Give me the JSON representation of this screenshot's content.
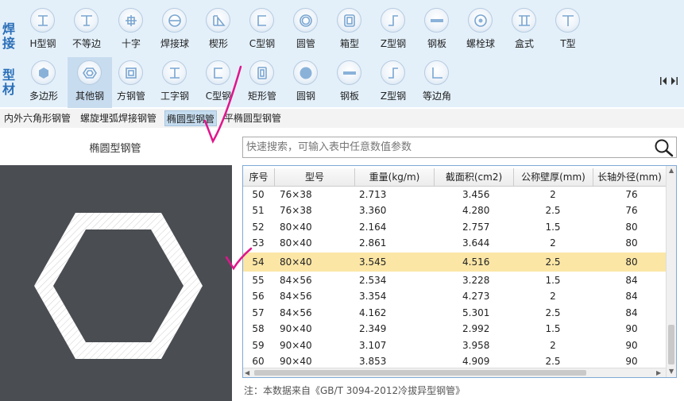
{
  "side_labels": {
    "top": [
      "焊",
      "接"
    ],
    "bottom": [
      "型",
      "材"
    ]
  },
  "toolbar": {
    "row1": [
      {
        "label": "H型钢",
        "icon": "h-beam-icon"
      },
      {
        "label": "不等边",
        "icon": "unequal-beam-icon"
      },
      {
        "label": "十字",
        "icon": "cross-icon"
      },
      {
        "label": "焊接球",
        "icon": "welded-ball-icon"
      },
      {
        "label": "楔形",
        "icon": "wedge-icon"
      },
      {
        "label": "C型钢",
        "icon": "c-channel-icon"
      },
      {
        "label": "圆管",
        "icon": "round-tube-icon"
      },
      {
        "label": "箱型",
        "icon": "box-section-icon"
      },
      {
        "label": "Z型钢",
        "icon": "z-section-icon"
      },
      {
        "label": "钢板",
        "icon": "steel-plate-icon"
      },
      {
        "label": "螺栓球",
        "icon": "bolt-ball-icon"
      },
      {
        "label": "盒式",
        "icon": "box-type-icon"
      },
      {
        "label": "T型",
        "icon": "t-section-icon"
      }
    ],
    "row2": [
      {
        "label": "多边形",
        "icon": "polygon-icon"
      },
      {
        "label": "其他钢",
        "icon": "other-steel-icon",
        "selected": true
      },
      {
        "label": "方钢管",
        "icon": "square-tube-icon"
      },
      {
        "label": "工字钢",
        "icon": "i-beam-icon"
      },
      {
        "label": "C型钢",
        "icon": "c-channel-icon"
      },
      {
        "label": "矩形管",
        "icon": "rect-tube-icon"
      },
      {
        "label": "圆钢",
        "icon": "round-bar-icon"
      },
      {
        "label": "钢板",
        "icon": "steel-plate-icon"
      },
      {
        "label": "Z型钢",
        "icon": "z-section-icon"
      },
      {
        "label": "等边角",
        "icon": "equal-angle-icon"
      }
    ]
  },
  "subtabs": [
    {
      "label": "内外六角形钢管"
    },
    {
      "label": "螺旋埋弧焊接钢管"
    },
    {
      "label": "椭圆型钢管",
      "active": true
    },
    {
      "label": "平椭圆型钢管"
    }
  ],
  "preview": {
    "title": "椭圆型钢管"
  },
  "search": {
    "placeholder": "快速搜索，可输入表中任意数值参数"
  },
  "table": {
    "columns": [
      "序号",
      "型号",
      "重量(kg/m)",
      "截面积(cm2)",
      "公称壁厚(mm)",
      "长轴外径(mm)"
    ],
    "rows": [
      [
        "50",
        "76×38",
        "2.713",
        "3.456",
        "2",
        "76"
      ],
      [
        "51",
        "76×38",
        "3.360",
        "4.280",
        "2.5",
        "76"
      ],
      [
        "52",
        "80×40",
        "2.164",
        "2.757",
        "1.5",
        "80"
      ],
      [
        "53",
        "80×40",
        "2.861",
        "3.644",
        "2",
        "80"
      ],
      [
        "54",
        "80×40",
        "3.545",
        "4.516",
        "2.5",
        "80"
      ],
      [
        "55",
        "84×56",
        "2.534",
        "3.228",
        "1.5",
        "84"
      ],
      [
        "56",
        "84×56",
        "3.354",
        "4.273",
        "2",
        "84"
      ],
      [
        "57",
        "84×56",
        "4.162",
        "5.301",
        "2.5",
        "84"
      ],
      [
        "58",
        "90×40",
        "2.349",
        "2.992",
        "1.5",
        "90"
      ],
      [
        "59",
        "90×40",
        "3.107",
        "3.958",
        "2",
        "90"
      ],
      [
        "60",
        "90×40",
        "3.853",
        "4.909",
        "2.5",
        "90"
      ]
    ],
    "highlighted_row": "54"
  },
  "note": "注：本数据来自《GB/T  3094-2012冷拔异型钢管》",
  "colors": {
    "toolbar_bg": "#e3f0fa",
    "side_label": "#2a6fb8",
    "highlight": "#fbe6a6",
    "preview_bg": "#4a4d52",
    "annotation": "#e0158c"
  }
}
